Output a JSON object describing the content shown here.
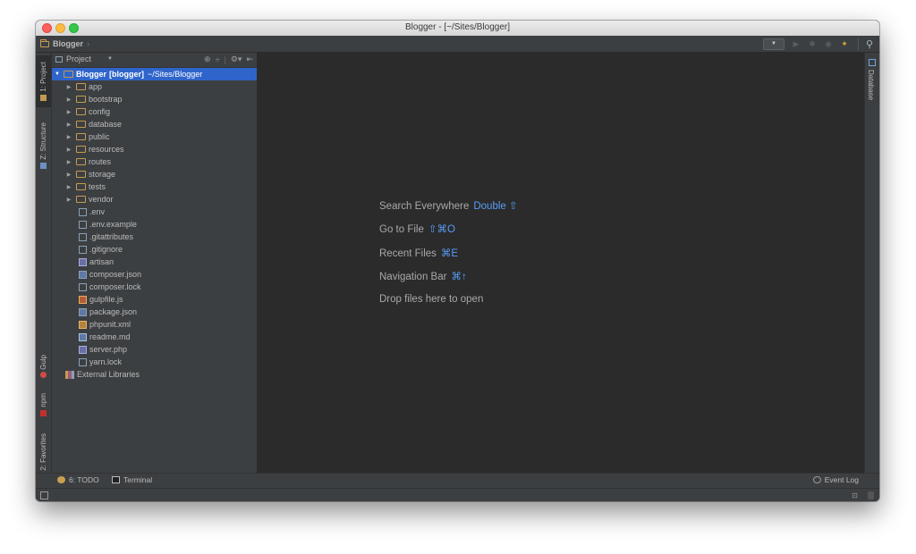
{
  "window": {
    "title": "Blogger - [~/Sites/Blogger]"
  },
  "navbar": {
    "breadcrumb": "Blogger"
  },
  "left_tool_tabs": {
    "project": "1: Project",
    "structure": "Z: Structure",
    "gulp": "Gulp",
    "npm": "npm",
    "favorites": "2: Favorites"
  },
  "right_tool_tabs": {
    "database": "Database"
  },
  "project_panel": {
    "title": "Project",
    "root": {
      "name": "Blogger",
      "module": "[blogger]",
      "path": "~/Sites/Blogger"
    },
    "folders": [
      "app",
      "bootstrap",
      "config",
      "database",
      "public",
      "resources",
      "routes",
      "storage",
      "tests",
      "vendor"
    ],
    "files": [
      {
        "name": ".env",
        "icon": "text-file-icon"
      },
      {
        "name": ".env.example",
        "icon": "text-file-icon"
      },
      {
        "name": ".gitattributes",
        "icon": "text-file-icon"
      },
      {
        "name": ".gitignore",
        "icon": "text-file-icon"
      },
      {
        "name": "artisan",
        "icon": "script-file-icon"
      },
      {
        "name": "composer.json",
        "icon": "json-file-icon"
      },
      {
        "name": "composer.lock",
        "icon": "text-file-icon"
      },
      {
        "name": "gulpfile.js",
        "icon": "js-file-icon"
      },
      {
        "name": "package.json",
        "icon": "json-file-icon"
      },
      {
        "name": "phpunit.xml",
        "icon": "xml-file-icon"
      },
      {
        "name": "readme.md",
        "icon": "markdown-file-icon"
      },
      {
        "name": "server.php",
        "icon": "php-file-icon"
      },
      {
        "name": "yarn.lock",
        "icon": "text-file-icon"
      }
    ],
    "external": "External Libraries"
  },
  "editor_hints": [
    {
      "label": "Search Everywhere",
      "shortcut": "Double ⇧"
    },
    {
      "label": "Go to File",
      "shortcut": "⇧⌘O"
    },
    {
      "label": "Recent Files",
      "shortcut": "⌘E"
    },
    {
      "label": "Navigation Bar",
      "shortcut": "⌘↑"
    },
    {
      "label": "Drop files here to open",
      "shortcut": ""
    }
  ],
  "bottom_bar": {
    "todo": "6: TODO",
    "terminal": "Terminal",
    "event_log": "Event Log"
  },
  "colors": {
    "accent": "#2f65ca",
    "shortcut": "#589df6",
    "background": "#2b2b2b",
    "panel": "#3c3f41"
  }
}
